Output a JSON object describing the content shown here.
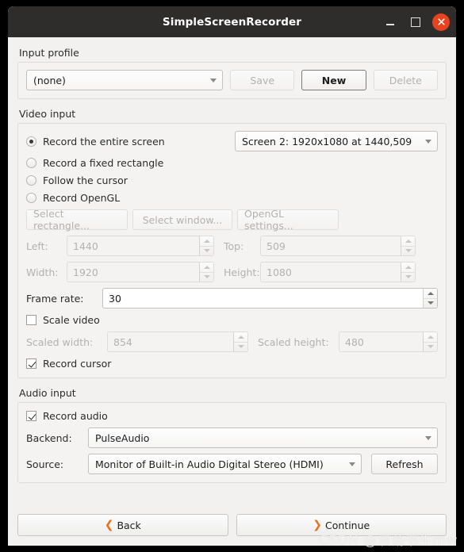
{
  "window": {
    "title": "SimpleScreenRecorder",
    "controls": {
      "minimize": "minimize-icon",
      "maximize": "maximize-icon",
      "close": "close-icon"
    }
  },
  "input_profile": {
    "group_label": "Input profile",
    "profile_value": "(none)",
    "save_label": "Save",
    "new_label": "New",
    "delete_label": "Delete"
  },
  "video_input": {
    "group_label": "Video input",
    "radios": [
      {
        "label": "Record the entire screen",
        "selected": true
      },
      {
        "label": "Record a fixed rectangle",
        "selected": false
      },
      {
        "label": "Follow the cursor",
        "selected": false
      },
      {
        "label": "Record OpenGL",
        "selected": false
      }
    ],
    "screen_value": "Screen 2: 1920x1080 at 1440,509",
    "select_rectangle_label": "Select rectangle...",
    "select_window_label": "Select window...",
    "opengl_settings_label": "OpenGL settings...",
    "left_label": "Left:",
    "left_value": "1440",
    "top_label": "Top:",
    "top_value": "509",
    "width_label": "Width:",
    "width_value": "1920",
    "height_label": "Height:",
    "height_value": "1080",
    "frame_rate_label": "Frame rate:",
    "frame_rate_value": "30",
    "scale_video_label": "Scale video",
    "scaled_width_label": "Scaled width:",
    "scaled_width_value": "854",
    "scaled_height_label": "Scaled height:",
    "scaled_height_value": "480",
    "record_cursor_label": "Record cursor"
  },
  "audio_input": {
    "group_label": "Audio input",
    "record_audio_label": "Record audio",
    "backend_label": "Backend:",
    "backend_value": "PulseAudio",
    "source_label": "Source:",
    "source_value": "Monitor of Built-in Audio Digital Stereo (HDMI)",
    "refresh_label": "Refresh"
  },
  "navigation": {
    "back_label": "Back",
    "back_chevron": "❮",
    "continue_label": "Continue",
    "continue_chevron": "❯"
  },
  "watermark": {
    "text": "CSDN @浪荡书生mw"
  },
  "colors": {
    "titlebar": "#2f2d2c",
    "close_button": "#e8431f",
    "accent_chevron": "#e8731f",
    "window_bg": "#f2f1f0"
  }
}
